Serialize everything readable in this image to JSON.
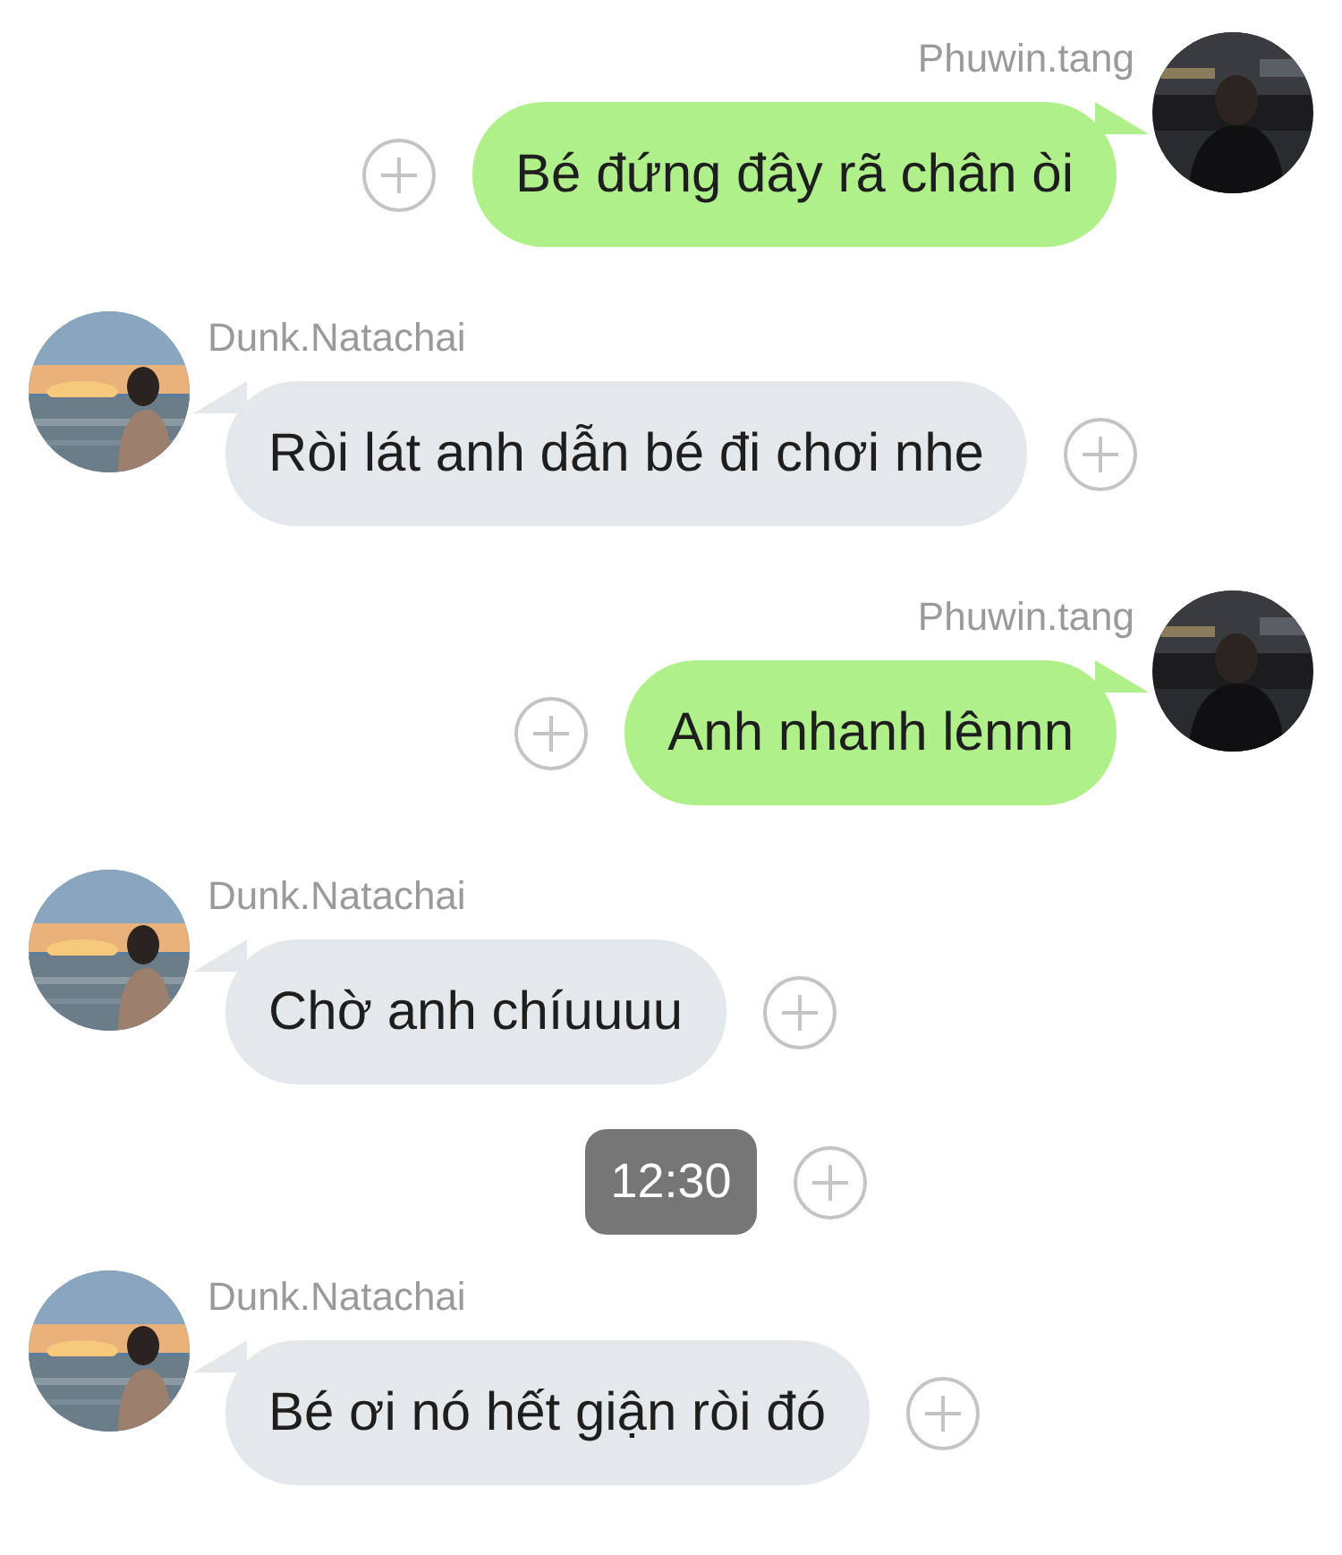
{
  "messages": [
    {
      "kind": "outgoing",
      "sender": "Phuwin.tang",
      "text": "Bé đứng đây rã chân òi"
    },
    {
      "kind": "incoming",
      "sender": "Dunk.Natachai",
      "text": "Ròi lát anh dẫn bé đi chơi nhe"
    },
    {
      "kind": "outgoing",
      "sender": "Phuwin.tang",
      "text": "Anh nhanh lênnn"
    },
    {
      "kind": "incoming",
      "sender": "Dunk.Natachai",
      "text": "Chờ anh chíuuuu"
    },
    {
      "kind": "time",
      "text": "12:30"
    },
    {
      "kind": "incoming",
      "sender": "Dunk.Natachai",
      "text": "Bé ơi nó hết giận ròi đó"
    }
  ]
}
